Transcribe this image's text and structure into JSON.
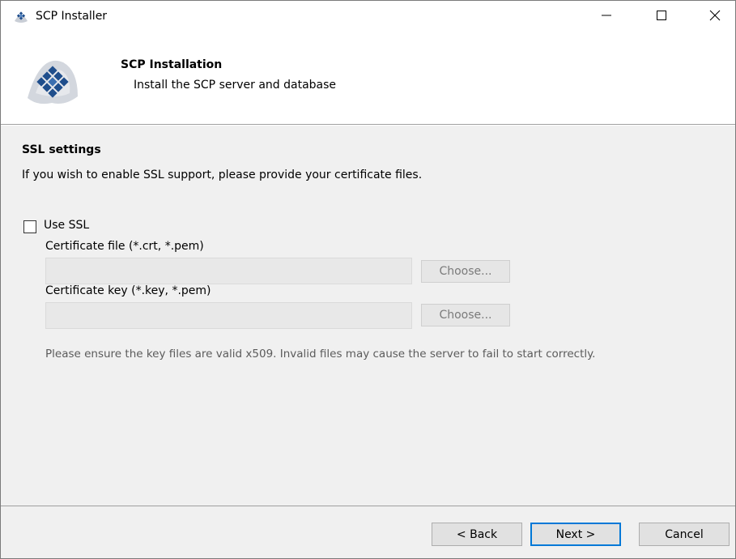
{
  "window": {
    "title": "SCP Installer",
    "icons": {
      "app": "scp-logo-icon",
      "minimize": "minimize-icon",
      "maximize": "maximize-icon",
      "close": "close-icon"
    }
  },
  "header": {
    "title": "SCP Installation",
    "subtitle": "Install the SCP server and database",
    "logo": "scp-logo"
  },
  "ssl": {
    "section_title": "SSL settings",
    "description": "If you wish to enable SSL support, please provide your certificate files.",
    "use_ssl_label": "Use SSL",
    "use_ssl_checked": false,
    "cert_file_label": "Certificate file (*.crt, *.pem)",
    "cert_file_value": "",
    "cert_key_label": "Certificate key (*.key, *.pem)",
    "cert_key_value": "",
    "choose_label": "Choose...",
    "note": "Please ensure the key files are valid x509. Invalid files may cause the server to fail to start correctly."
  },
  "footer": {
    "back_label": "< Back",
    "next_label": "Next >",
    "cancel_label": "Cancel"
  },
  "colors": {
    "window_bg": "#f0f0f0",
    "header_bg": "#ffffff",
    "focus_border": "#0078d7",
    "logo_blue": "#1f4e8c"
  }
}
